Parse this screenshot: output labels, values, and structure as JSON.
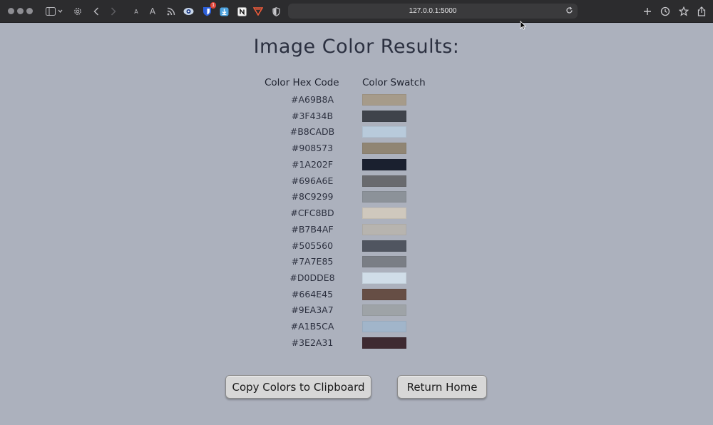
{
  "browser": {
    "address": "127.0.0.1:5000",
    "extension_badge": "1",
    "text_small_label": "A",
    "text_large_label": "A"
  },
  "page": {
    "title": "Image Color Results:",
    "col_hex_header": "Color Hex Code",
    "col_swatch_header": "Color Swatch",
    "colors": [
      {
        "hex": "#A69B8A",
        "color": "#A69B8A"
      },
      {
        "hex": "#3F434B",
        "color": "#3F434B"
      },
      {
        "hex": "#B8CADB",
        "color": "#B8CADB"
      },
      {
        "hex": "#908573",
        "color": "#908573"
      },
      {
        "hex": "#1A202F",
        "color": "#1A202F"
      },
      {
        "hex": "#696A6E",
        "color": "#696A6E"
      },
      {
        "hex": "#8C9299",
        "color": "#8C9299"
      },
      {
        "hex": "#CFC8BD",
        "color": "#CFC8BD"
      },
      {
        "hex": "#B7B4AF",
        "color": "#B7B4AF"
      },
      {
        "hex": "#505560",
        "color": "#505560"
      },
      {
        "hex": "#7A7E85",
        "color": "#7A7E85"
      },
      {
        "hex": "#D0DDE8",
        "color": "#D0DDE8"
      },
      {
        "hex": "#664E45",
        "color": "#664E45"
      },
      {
        "hex": "#9EA3A7",
        "color": "#9EA3A7"
      },
      {
        "hex": "#A1B5CA",
        "color": "#A1B5CA"
      },
      {
        "hex": "#3E2A31",
        "color": "#3E2A31"
      }
    ],
    "copy_button": "Copy Colors to Clipboard",
    "home_button": "Return Home"
  }
}
